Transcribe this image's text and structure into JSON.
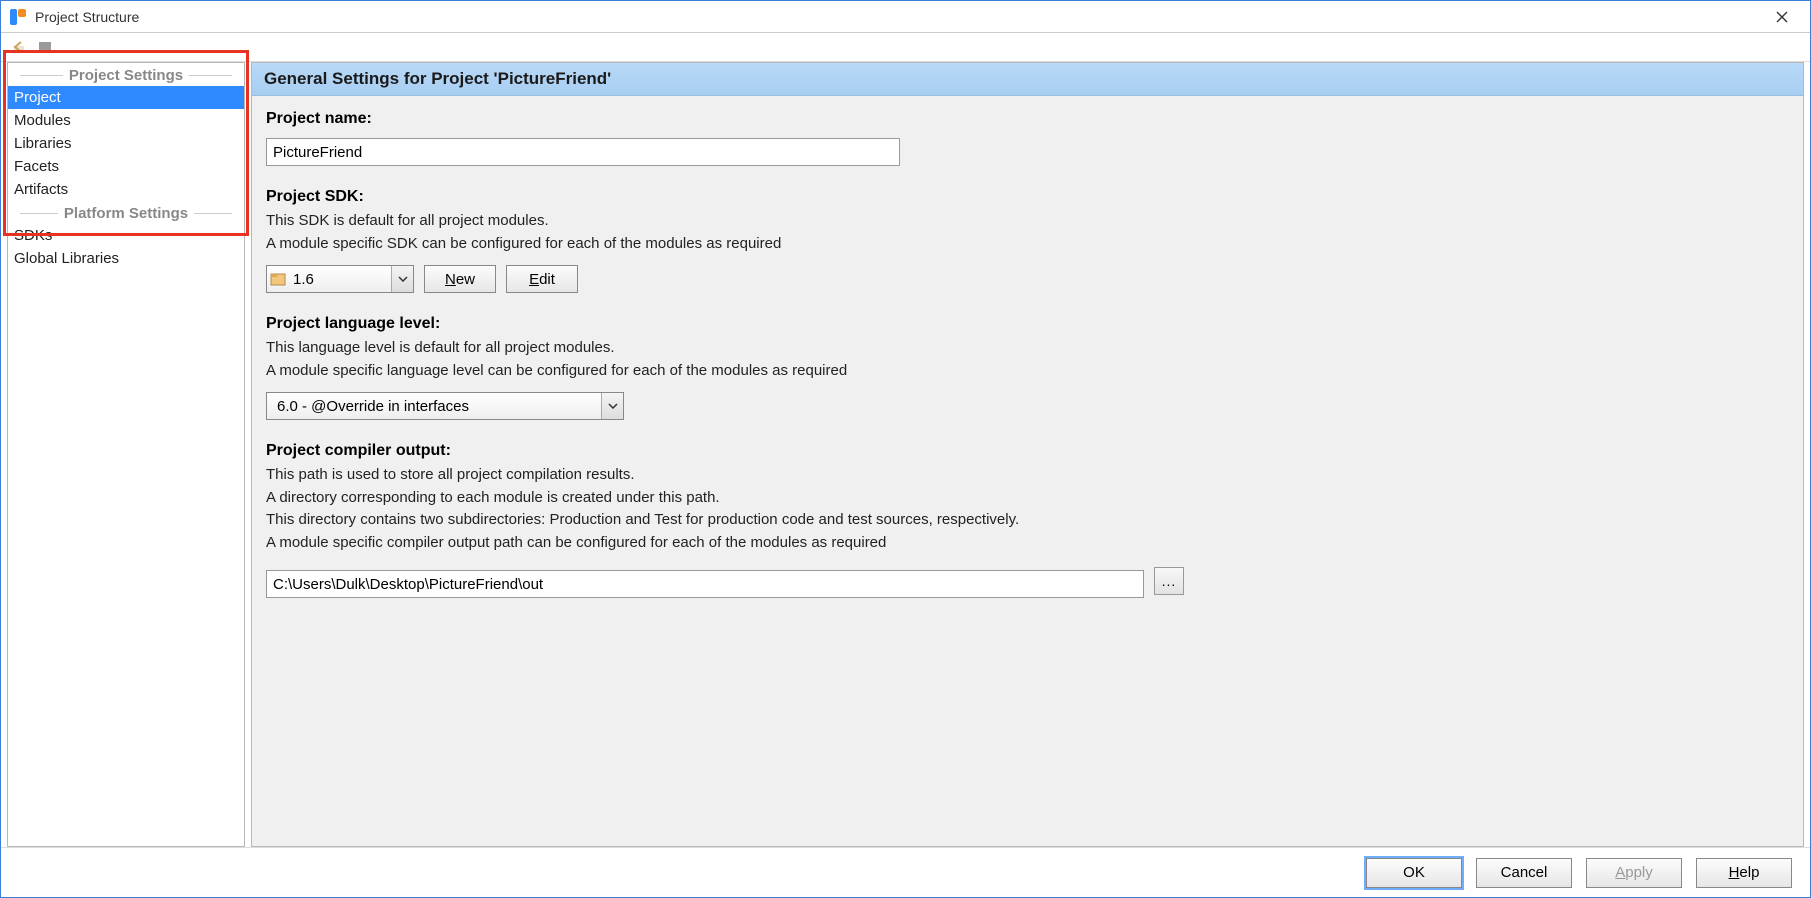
{
  "window": {
    "title": "Project Structure"
  },
  "sidebar": {
    "section1_title": "Project Settings",
    "section2_title": "Platform Settings",
    "items1": [
      {
        "label": "Project",
        "selected": true
      },
      {
        "label": "Modules"
      },
      {
        "label": "Libraries"
      },
      {
        "label": "Facets"
      },
      {
        "label": "Artifacts"
      }
    ],
    "items2": [
      {
        "label": "SDKs"
      },
      {
        "label": "Global Libraries"
      }
    ]
  },
  "main": {
    "header": "General Settings for Project 'PictureFriend'",
    "project_name": {
      "label": "Project name:",
      "value": "PictureFriend"
    },
    "project_sdk": {
      "label": "Project SDK:",
      "desc1": "This SDK is default for all project modules.",
      "desc2": "A module specific SDK can be configured for each of the modules as required",
      "selected": "1.6",
      "new_label": "New",
      "edit_label": "Edit"
    },
    "language_level": {
      "label": "Project language level:",
      "desc1": "This language level is default for all project modules.",
      "desc2": "A module specific language level can be configured for each of the modules as required",
      "selected": "6.0 - @Override in interfaces"
    },
    "compiler_output": {
      "label": "Project compiler output:",
      "desc1": "This path is used to store all project compilation results.",
      "desc2": "A directory corresponding to each module is created under this path.",
      "desc3": "This directory contains two subdirectories: Production and Test for production code and test sources, respectively.",
      "desc4": "A module specific compiler output path can be configured for each of the modules as required",
      "value": "C:\\Users\\Dulk\\Desktop\\PictureFriend\\out",
      "browse": "..."
    }
  },
  "footer": {
    "ok": "OK",
    "cancel": "Cancel",
    "apply": "Apply",
    "help": "Help"
  }
}
